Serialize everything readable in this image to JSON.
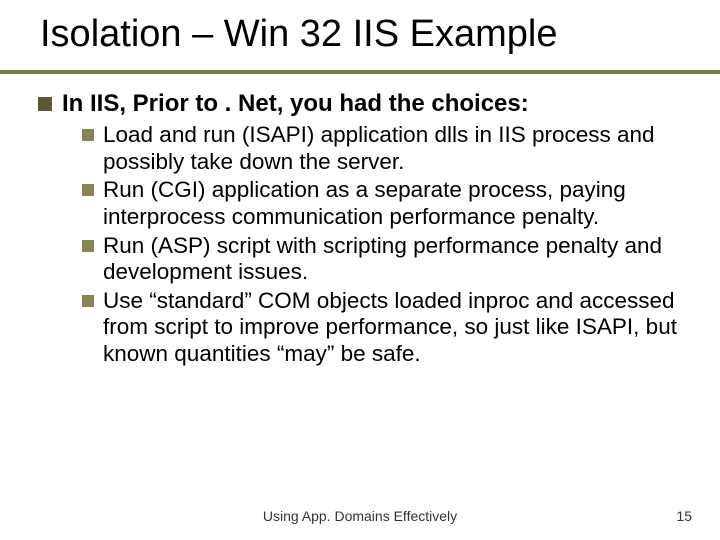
{
  "title": "Isolation – Win 32 IIS Example",
  "main_point": "In IIS, Prior to . Net, you had the choices:",
  "sub_points": [
    "Load and run (ISAPI) application dlls in IIS process and possibly take down the server.",
    "Run (CGI) application as a separate process, paying interprocess communication performance penalty.",
    "Run (ASP) script with scripting performance penalty and development issues.",
    "Use “standard” COM objects loaded inproc and accessed from script to improve performance, so just like ISAPI, but known quantities “may” be safe."
  ],
  "footer": "Using App. Domains Effectively",
  "page_number": "15"
}
